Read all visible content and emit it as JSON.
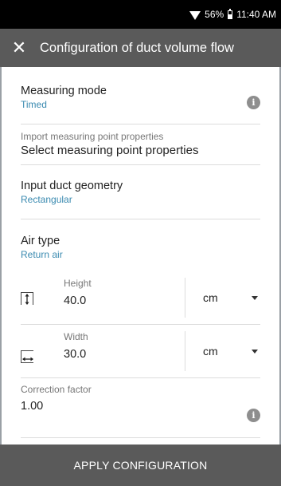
{
  "status_bar": {
    "battery": "56%",
    "time": "11:40 AM",
    "icons": [
      "wifi-icon",
      "battery-icon"
    ]
  },
  "app_bar": {
    "close_icon": "close-icon",
    "title": "Configuration of duct volume flow"
  },
  "measuring_mode": {
    "label": "Measuring mode",
    "value": "Timed",
    "info_icon": "info-icon"
  },
  "import_props": {
    "label": "Import measuring point properties",
    "value": "Select measuring point properties"
  },
  "duct_geometry": {
    "label": "Input duct geometry",
    "value": "Rectangular"
  },
  "air_type": {
    "label": "Air type",
    "value": "Return air"
  },
  "height": {
    "label": "Height",
    "value": "40.0",
    "unit": "cm",
    "icon": "height-icon"
  },
  "width": {
    "label": "Width",
    "value": "30.0",
    "unit": "cm",
    "icon": "width-icon"
  },
  "correction": {
    "label": "Correction factor",
    "value": "1.00",
    "info_icon": "info-icon"
  },
  "apply_button": {
    "label": "APPLY CONFIGURATION"
  },
  "colors": {
    "app_bar": "#5a5a5a",
    "accent_value": "#3a8ab0",
    "status_bar": "#000000"
  }
}
